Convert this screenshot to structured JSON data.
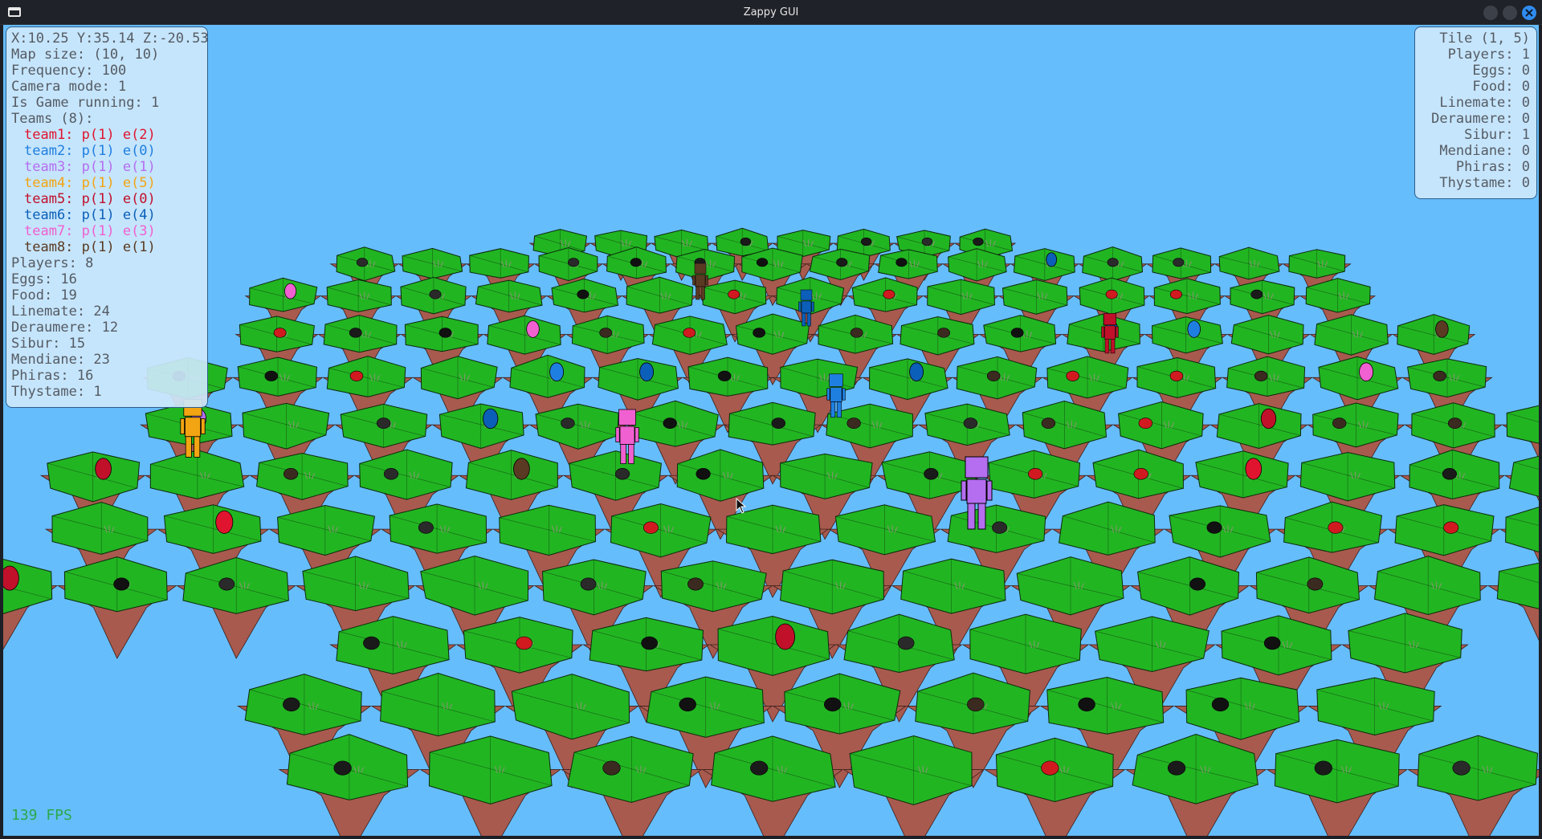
{
  "window": {
    "title": "Zappy GUI"
  },
  "hud": {
    "coords": "X:10.25 Y:35.14 Z:-20.53",
    "map_size": "Map size: (10, 10)",
    "frequency": "Frequency: 100",
    "camera_mode": "Camera mode: 1",
    "game_running": "Is Game running: 1",
    "teams_header": "Teams (8):",
    "teams": [
      {
        "name": "team1:",
        "stats": "p(1) e(2)",
        "color": "#e0142e"
      },
      {
        "name": "team2:",
        "stats": "p(1) e(0)",
        "color": "#1f7fe0"
      },
      {
        "name": "team3:",
        "stats": "p(1) e(1)",
        "color": "#b56ef0"
      },
      {
        "name": "team4:",
        "stats": "p(1) e(5)",
        "color": "#f2a412"
      },
      {
        "name": "team5:",
        "stats": "p(1) e(0)",
        "color": "#c0102a"
      },
      {
        "name": "team6:",
        "stats": "p(1) e(4)",
        "color": "#0b5fb8"
      },
      {
        "name": "team7:",
        "stats": "p(1) e(3)",
        "color": "#f060d0"
      },
      {
        "name": "team8:",
        "stats": "p(1) e(1)",
        "color": "#5a3a22"
      }
    ],
    "players": "Players: 8",
    "eggs": "Eggs: 16",
    "food": "Food: 19",
    "linemate": "Linemate: 24",
    "deraumere": "Deraumere: 12",
    "sibur": "Sibur: 15",
    "mendiane": "Mendiane: 23",
    "phiras": "Phiras: 16",
    "thystame": "Thystame: 1"
  },
  "tile_info": {
    "title": "Tile (1, 5)",
    "players": "Players: 1",
    "eggs": "Eggs: 0",
    "food": "Food: 0",
    "linemate": "Linemate: 0",
    "deraumere": "Deraumere: 0",
    "sibur": "Sibur: 1",
    "mendiane": "Mendiane: 0",
    "phiras": "Phiras: 0",
    "thystame": "Thystame: 0"
  },
  "fps": "139 FPS",
  "colors": {
    "sky": "#66bdfb",
    "grass": "#22b522",
    "dirt": "#a85a4e",
    "panel_bg": "#cde8fc",
    "panel_border": "#2c5d8c",
    "hud_text": "#555b63",
    "fps_text": "#2aa94a"
  }
}
